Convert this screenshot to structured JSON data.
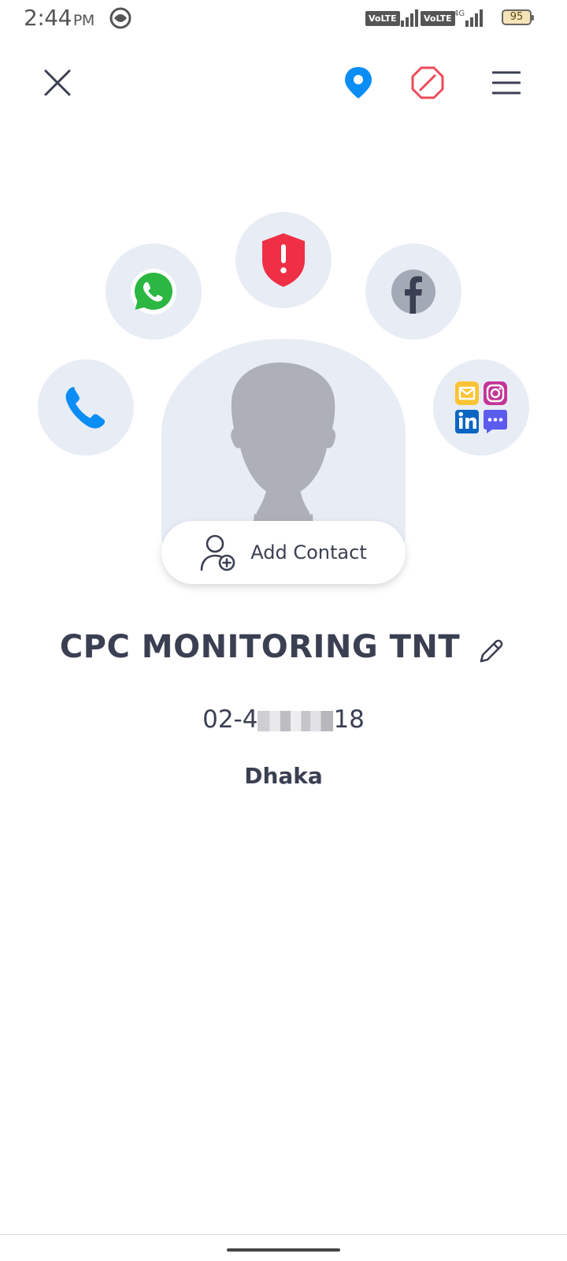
{
  "status_bar": {
    "time": "2:44",
    "ampm": "PM",
    "volte1": "VoLTE",
    "volte2": "VoLTE",
    "network": "4G",
    "battery": "95"
  },
  "toolbar": {
    "close_icon": "close-icon",
    "location_icon": "location-pin-icon",
    "block_icon": "block-icon",
    "menu_icon": "menu-icon"
  },
  "actions": [
    "call-icon",
    "whatsapp-icon",
    "spam-shield-icon",
    "facebook-icon",
    "social-apps-icon"
  ],
  "contact": {
    "add_contact_label": "Add Contact",
    "name": "CPC MONITORING TNT",
    "phone_prefix": "02-4",
    "phone_suffix": "18",
    "location": "Dhaka"
  },
  "colors": {
    "accent_blue": "#0a8df5",
    "block_red": "#ee4a5a",
    "spam_red": "#ee2f45",
    "bubble_bg": "#e8ecf5",
    "text_dark": "#3b3f52"
  }
}
